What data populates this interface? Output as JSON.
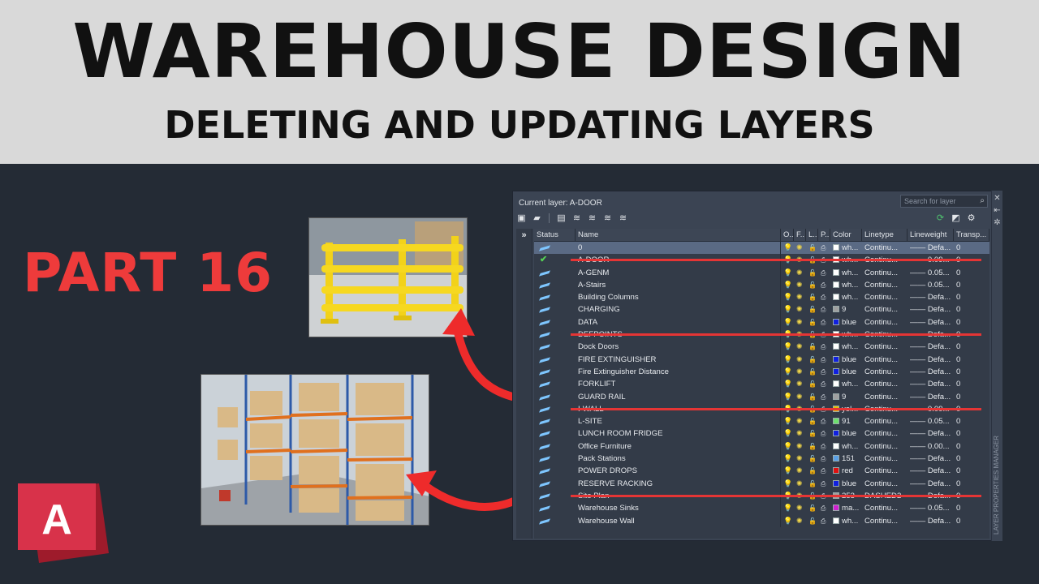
{
  "banner": {
    "title": "WAREHOUSE DESIGN",
    "subtitle": "DELETING AND UPDATING LAYERS"
  },
  "part_label": "PART 16",
  "logo": {
    "letter": "A",
    "color": "#d32f3f"
  },
  "accent_red": "#ee3b3b",
  "layer_panel": {
    "current_layer": "Current layer: A-DOOR",
    "search_placeholder": "Search for layer",
    "tree_toggle": "»",
    "side_tab": "LAYER PROPERTIES MANAGER",
    "headers": {
      "status": "Status",
      "name": "Name",
      "on": "O..",
      "freeze": "F..",
      "lock": "L..",
      "plot": "P..",
      "color": "Color",
      "linetype": "Linetype",
      "lineweight": "Lineweight",
      "transparency": "Transp..."
    },
    "layers": [
      {
        "status": "layer",
        "name": "0",
        "lock": "yellow",
        "color_hex": "#ffffff",
        "color": "wh...",
        "linetype": "Continu...",
        "lineweight": "—— Defa...",
        "transparency": "0",
        "selected": true,
        "struck": false
      },
      {
        "status": "current",
        "name": "A-DOOR",
        "lock": "yellow",
        "color_hex": "#ffffff",
        "color": "wh...",
        "linetype": "Continu...",
        "lineweight": "—— 0.09...",
        "transparency": "0",
        "selected": false,
        "struck": true
      },
      {
        "status": "layer",
        "name": "A-GENM",
        "lock": "yellow",
        "color_hex": "#ffffff",
        "color": "wh...",
        "linetype": "Continu...",
        "lineweight": "—— 0.05...",
        "transparency": "0",
        "selected": false,
        "struck": false
      },
      {
        "status": "layer",
        "name": "A-Stairs",
        "lock": "yellow",
        "color_hex": "#ffffff",
        "color": "wh...",
        "linetype": "Continu...",
        "lineweight": "—— 0.05...",
        "transparency": "0",
        "selected": false,
        "struck": false
      },
      {
        "status": "layer",
        "name": "Building Columns",
        "lock": "blue",
        "color_hex": "#ffffff",
        "color": "wh...",
        "linetype": "Continu...",
        "lineweight": "—— Defa...",
        "transparency": "0",
        "selected": false,
        "struck": false
      },
      {
        "status": "layer",
        "name": "CHARGING",
        "lock": "yellow",
        "color_hex": "#a0a0a0",
        "color": "9",
        "linetype": "Continu...",
        "lineweight": "—— Defa...",
        "transparency": "0",
        "selected": false,
        "struck": false
      },
      {
        "status": "layer",
        "name": "DATA",
        "lock": "yellow",
        "color_hex": "#1020e0",
        "color": "blue",
        "linetype": "Continu...",
        "lineweight": "—— Defa...",
        "transparency": "0",
        "selected": false,
        "struck": false
      },
      {
        "status": "layer",
        "name": "DEFPOINTS",
        "lock": "yellow",
        "color_hex": "#ffffff",
        "color": "wh...",
        "linetype": "Continu...",
        "lineweight": "—— Defa...",
        "transparency": "0",
        "selected": false,
        "struck": true
      },
      {
        "status": "layer",
        "name": "Dock Doors",
        "lock": "yellow",
        "color_hex": "#ffffff",
        "color": "wh...",
        "linetype": "Continu...",
        "lineweight": "—— Defa...",
        "transparency": "0",
        "selected": false,
        "struck": false
      },
      {
        "status": "layer",
        "name": "FIRE EXTINGUISHER",
        "lock": "yellow",
        "color_hex": "#1020e0",
        "color": "blue",
        "linetype": "Continu...",
        "lineweight": "—— Defa...",
        "transparency": "0",
        "selected": false,
        "struck": false
      },
      {
        "status": "layer",
        "name": "Fire Extinguisher Distance",
        "lock": "yellow",
        "color_hex": "#1020e0",
        "color": "blue",
        "linetype": "Continu...",
        "lineweight": "—— Defa...",
        "transparency": "0",
        "selected": false,
        "struck": false
      },
      {
        "status": "layer",
        "name": "FORKLIFT",
        "lock": "yellow",
        "color_hex": "#ffffff",
        "color": "wh...",
        "linetype": "Continu...",
        "lineweight": "—— Defa...",
        "transparency": "0",
        "selected": false,
        "struck": false
      },
      {
        "status": "layer",
        "name": "GUARD RAIL",
        "lock": "yellow",
        "color_hex": "#a0a0a0",
        "color": "9",
        "linetype": "Continu...",
        "lineweight": "—— Defa...",
        "transparency": "0",
        "selected": false,
        "struck": false
      },
      {
        "status": "layer",
        "name": "I-WALL",
        "lock": "yellow",
        "color_hex": "#e6c000",
        "color": "yel...",
        "linetype": "Continu...",
        "lineweight": "—— 0.09...",
        "transparency": "0",
        "selected": false,
        "struck": true
      },
      {
        "status": "layer",
        "name": "L-SITE",
        "lock": "yellow",
        "color_hex": "#6ee06e",
        "color": "91",
        "linetype": "Continu...",
        "lineweight": "—— 0.05...",
        "transparency": "0",
        "selected": false,
        "struck": false
      },
      {
        "status": "layer",
        "name": "LUNCH ROOM FRIDGE",
        "lock": "yellow",
        "color_hex": "#1020e0",
        "color": "blue",
        "linetype": "Continu...",
        "lineweight": "—— Defa...",
        "transparency": "0",
        "selected": false,
        "struck": false
      },
      {
        "status": "layer",
        "name": "Office Furniture",
        "lock": "yellow",
        "color_hex": "#ffffff",
        "color": "wh...",
        "linetype": "Continu...",
        "lineweight": "—— 0.00...",
        "transparency": "0",
        "selected": false,
        "struck": false
      },
      {
        "status": "layer",
        "name": "Pack Stations",
        "lock": "yellow",
        "color_hex": "#5aa0e6",
        "color": "151",
        "linetype": "Continu...",
        "lineweight": "—— Defa...",
        "transparency": "0",
        "selected": false,
        "struck": false
      },
      {
        "status": "layer",
        "name": "POWER DROPS",
        "lock": "yellow",
        "color_hex": "#e01010",
        "color": "red",
        "linetype": "Continu...",
        "lineweight": "—— Defa...",
        "transparency": "0",
        "selected": false,
        "struck": false
      },
      {
        "status": "layer",
        "name": "RESERVE RACKING",
        "lock": "yellow",
        "color_hex": "#1020e0",
        "color": "blue",
        "linetype": "Continu...",
        "lineweight": "—— Defa...",
        "transparency": "0",
        "selected": false,
        "struck": false
      },
      {
        "status": "layer",
        "name": "Site Plan",
        "lock": "yellow",
        "color_hex": "#a0a0a0",
        "color": "253",
        "linetype": "DASHED2",
        "lineweight": "—— Defa...",
        "transparency": "0",
        "selected": false,
        "struck": true
      },
      {
        "status": "layer",
        "name": "Warehouse Sinks",
        "lock": "yellow",
        "color_hex": "#d020d0",
        "color": "ma...",
        "linetype": "Continu...",
        "lineweight": "—— 0.05...",
        "transparency": "0",
        "selected": false,
        "struck": false
      },
      {
        "status": "layer",
        "name": "Warehouse Wall",
        "lock": "blue",
        "color_hex": "#ffffff",
        "color": "wh...",
        "linetype": "Continu...",
        "lineweight": "—— Defa...",
        "transparency": "0",
        "selected": false,
        "struck": false
      }
    ]
  }
}
